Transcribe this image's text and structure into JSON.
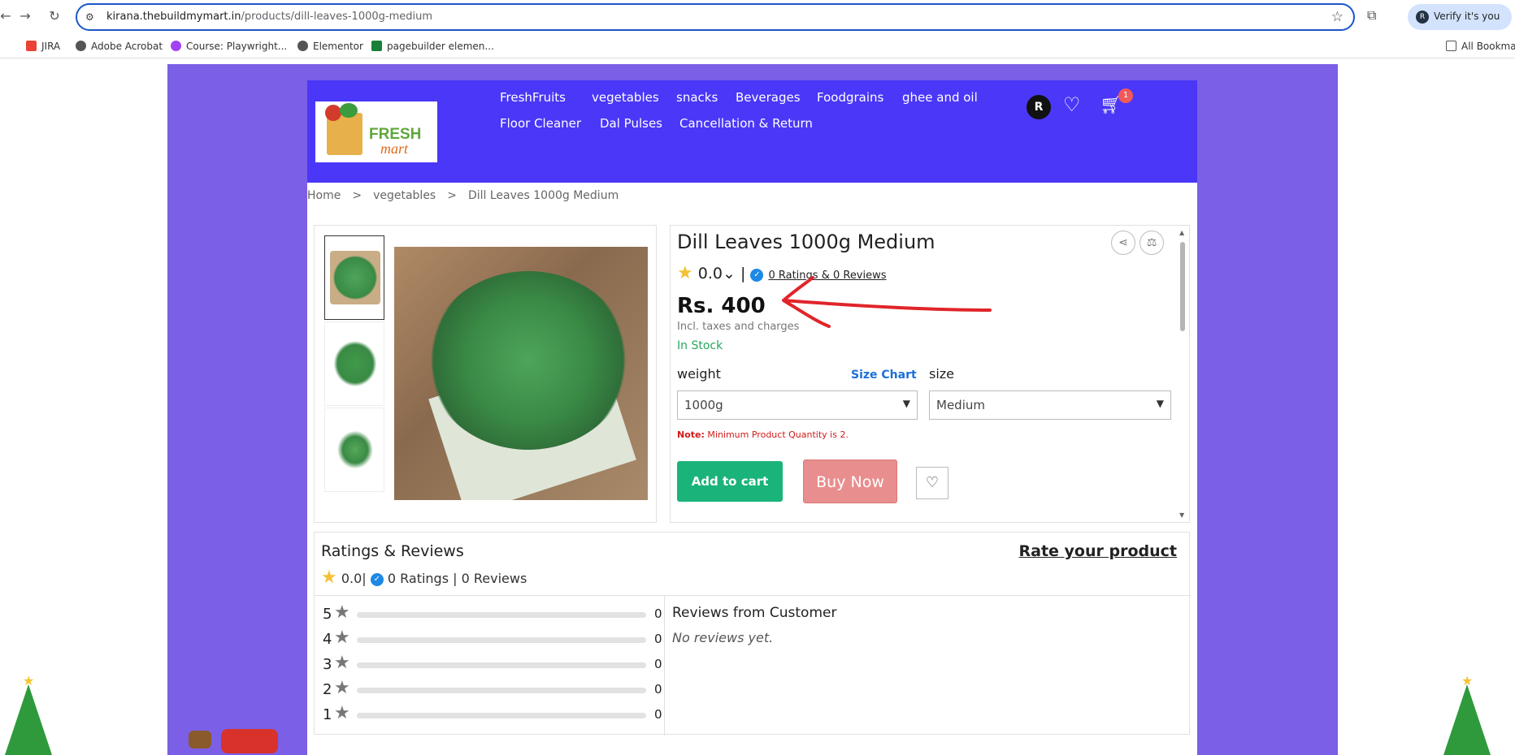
{
  "browser": {
    "url_host": "kirana.thebuildmymart.in",
    "url_path": "/products/dill-leaves-1000g-medium",
    "verify_label": "Verify it's you",
    "verify_avatar": "R",
    "bookmarks": [
      {
        "label": "JIRA",
        "color": "#ea4335"
      },
      {
        "label": "Adobe Acrobat",
        "color": "#555555"
      },
      {
        "label": "Course: Playwright...",
        "color": "#a142f4"
      },
      {
        "label": "Elementor",
        "color": "#555555"
      },
      {
        "label": "pagebuilder elemen...",
        "color": "#188038"
      },
      {
        "label": "All Bookmarks",
        "color": "#555555"
      }
    ]
  },
  "site": {
    "logo_top": "FRESH",
    "logo_bottom": "mart",
    "menu": [
      "FreshFruits",
      "vegetables",
      "snacks",
      "Beverages",
      "Foodgrains",
      "ghee and oil",
      "Floor Cleaner",
      "Dal Pulses",
      "Cancellation & Return"
    ],
    "avatar": "R",
    "cart_count": "1",
    "header_color": "#4a37f7",
    "page_bg_color": "#7b5fe6"
  },
  "breadcrumb": {
    "home": "Home",
    "sep1": ">",
    "category": "vegetables",
    "sep2": ">",
    "current": "Dill Leaves 1000g Medium"
  },
  "product": {
    "title": "Dill Leaves 1000g Medium",
    "rating": "0.0",
    "rating_chevron": "⌄",
    "divider": "|",
    "ratings_link": "0 Ratings  & 0 Reviews",
    "price": "Rs. 400",
    "incl": "Incl. taxes and charges",
    "stock": "In Stock",
    "weight_label": "weight",
    "size_chart": "Size Chart",
    "size_label": "size",
    "weight_value": "1000g",
    "size_value": "Medium",
    "note_label": "Note:",
    "note_text": "Minimum Product Quantity is 2.",
    "add_to_cart": "Add to cart",
    "buy_now": "Buy Now"
  },
  "reviews": {
    "title": "Ratings & Reviews",
    "rate_link": "Rate your product",
    "avg": "0.0",
    "summary": "0 Ratings | 0 Reviews",
    "bars": [
      {
        "stars": "5",
        "count": "0",
        "fraction": 0
      },
      {
        "stars": "4",
        "count": "0",
        "fraction": 0
      },
      {
        "stars": "3",
        "count": "0",
        "fraction": 0
      },
      {
        "stars": "2",
        "count": "0",
        "fraction": 0
      },
      {
        "stars": "1",
        "count": "0",
        "fraction": 0
      }
    ],
    "customer_title": "Reviews from Customer",
    "none": "No reviews yet."
  }
}
